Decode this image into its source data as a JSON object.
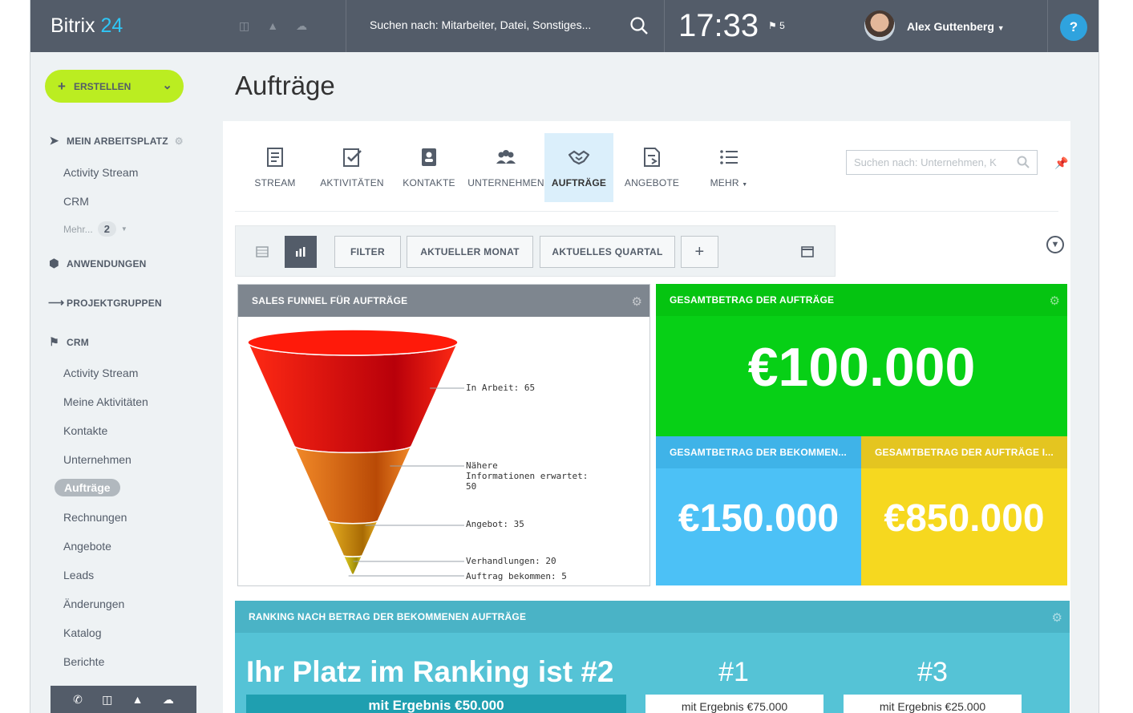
{
  "header": {
    "logo_a": "Bitrix",
    "logo_b": "24",
    "search": "Suchen nach: Mitarbeiter, Datei, Sonstiges...",
    "time": "17:33",
    "flag_count": "5",
    "user": "Alex Guttenberg",
    "help": "?"
  },
  "sidebar": {
    "create": "ERSTELLEN",
    "workspace": "MEIN ARBEITSPLATZ",
    "ws_items": [
      "Activity Stream",
      "CRM"
    ],
    "more_label": "Mehr...",
    "more_count": "2",
    "apps": "ANWENDUNGEN",
    "groups": "PROJEKTGRUPPEN",
    "crm": "CRM",
    "crm_items": [
      "Activity Stream",
      "Meine Aktivitäten",
      "Kontakte",
      "Unternehmen",
      "Aufträge",
      "Rechnungen",
      "Angebote",
      "Leads",
      "Änderungen",
      "Katalog",
      "Berichte"
    ]
  },
  "page": {
    "title": "Aufträge"
  },
  "tabs": [
    "STREAM",
    "AKTIVITÄTEN",
    "KONTAKTE",
    "UNTERNEHMEN",
    "AUFTRÄGE",
    "ANGEBOTE",
    "MEHR"
  ],
  "search_placeholder": "Suchen nach: Unternehmen, K",
  "filters": {
    "filter": "FILTER",
    "month": "AKTUELLER MONAT",
    "quarter": "AKTUELLES QUARTAL",
    "add": "+"
  },
  "widgets": {
    "funnel_title": "SALES FUNNEL FÜR AUFTRÄGE",
    "total_title": "GESAMTBETRAG DER AUFTRÄGE",
    "total_value": "€100.000",
    "won_title": "GESAMTBETRAG DER BEKOMMEN...",
    "won_value": "€150.000",
    "work_title": "GESAMTBETRAG DER AUFTRÄGE I...",
    "work_value": "€850.000",
    "rank_title": "RANKING NACH BETRAG DER BEKOMMENEN AUFTRÄGE",
    "rank_text": "Ihr Platz im Ranking ist #2",
    "rank_me": "mit Ergebnis €50.000",
    "rank1": "#1",
    "rank1_val": "mit Ergebnis €75.000",
    "rank3": "#3",
    "rank3_val": "mit Ergebnis €25.000"
  },
  "chart_data": {
    "type": "funnel",
    "categories": [
      "In Arbeit",
      "Nähere Informationen erwartet",
      "Angebot",
      "Verhandlungen",
      "Auftrag bekommen"
    ],
    "values": [
      65,
      50,
      35,
      20,
      5
    ],
    "labels": [
      "In Arbeit: 65",
      "Nähere",
      "Informationen erwartet:",
      "50",
      "Angebot: 35",
      "Verhandlungen: 20",
      "Auftrag bekommen: 5"
    ],
    "colors": [
      "#e8140a",
      "#e06a10",
      "#d69a0c",
      "#c6b40a",
      "#a8a40c"
    ]
  }
}
